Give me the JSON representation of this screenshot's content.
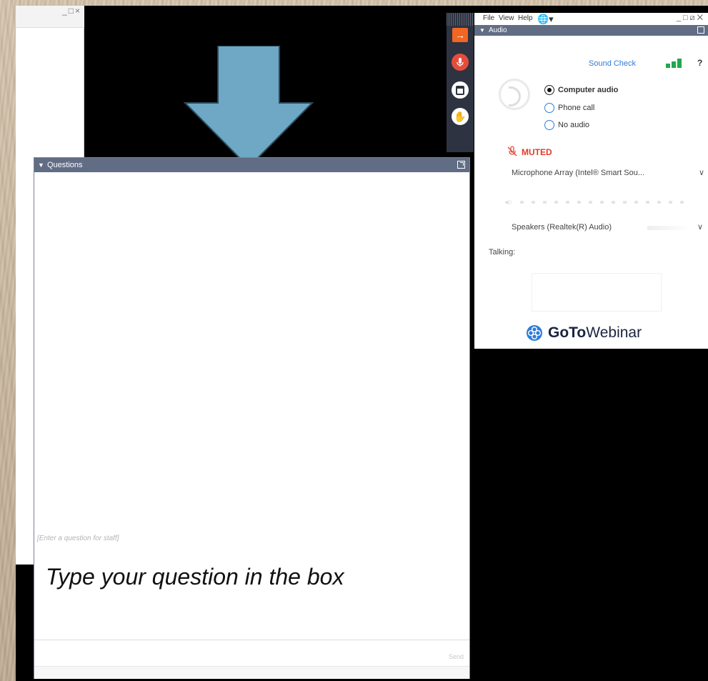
{
  "background_window": {
    "controls": "_□×"
  },
  "arrow": {
    "color": "#6ea8c4"
  },
  "questions_panel": {
    "title": "Questions",
    "input_placeholder": "[Enter a question for staff]",
    "instruction_caption": "Type your question in the box",
    "send_label": "Send",
    "header_color": "#616d85"
  },
  "control_strip": {
    "items": [
      {
        "icon": "arrow-right-icon",
        "glyph": "→",
        "color": "#f26522"
      },
      {
        "icon": "microphone-muted-icon",
        "glyph": "🎙",
        "color": "#e64c3c"
      },
      {
        "icon": "window-icon",
        "glyph": "",
        "color": "#ffffff"
      },
      {
        "icon": "raise-hand-icon",
        "glyph": "✋",
        "color": "#ffffff"
      }
    ]
  },
  "goto_panel": {
    "menu": {
      "file": "File",
      "view": "View",
      "help": "Help",
      "globe_glyph": "🌐▾"
    },
    "window_controls": "_□⧄✕",
    "audio_section": {
      "title": "Audio",
      "sound_check": "Sound Check",
      "help_glyph": "?",
      "options": [
        {
          "label": "Computer audio",
          "selected": true
        },
        {
          "label": "Phone call",
          "selected": false
        },
        {
          "label": "No audio",
          "selected": false
        }
      ],
      "muted_label": "MUTED",
      "microphone": "Microphone Array (Intel® Smart Sou...",
      "speakers": "Speakers (Realtek(R) Audio)",
      "talking_label": "Talking:"
    },
    "brand": {
      "bold": "GoTo",
      "regular": "Webinar",
      "color": "#1b2340",
      "accent": "#2f7dd8"
    }
  }
}
